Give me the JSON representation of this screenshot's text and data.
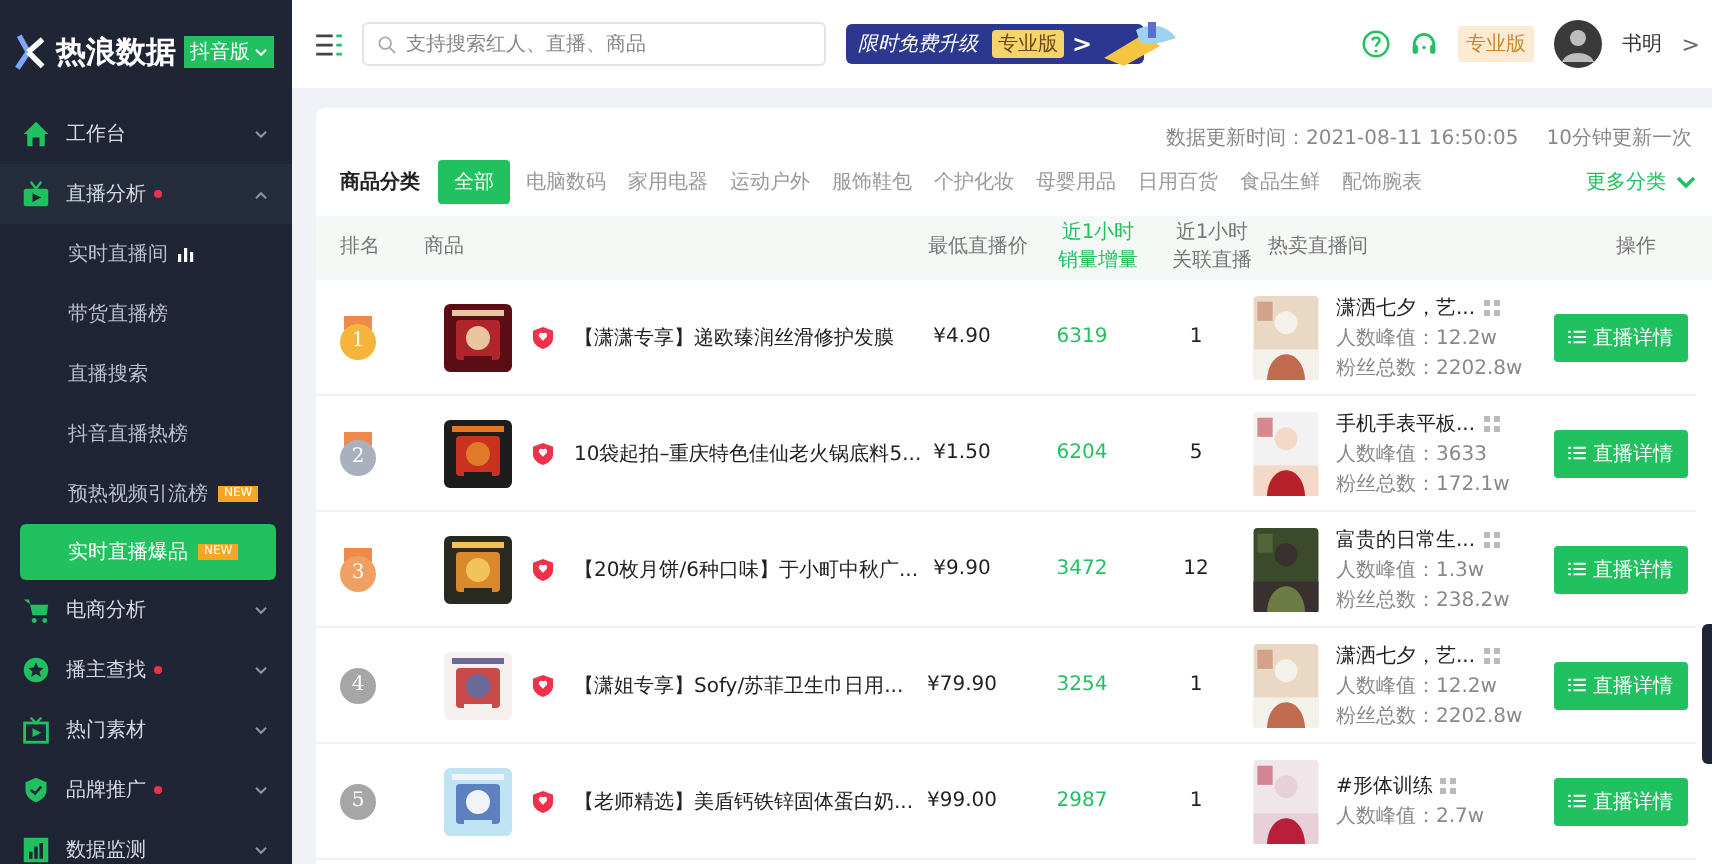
{
  "sidebar": {
    "logo": {
      "title": "热浪数据",
      "edition": "抖音版"
    },
    "items": [
      {
        "label": "工作台",
        "dot": false,
        "expanded": false
      },
      {
        "label": "直播分析",
        "dot": true,
        "expanded": true,
        "children": [
          {
            "label": "实时直播间",
            "selected": false,
            "chart_icon": true
          },
          {
            "label": "带货直播榜",
            "selected": false
          },
          {
            "label": "直播搜索",
            "selected": false
          },
          {
            "label": "抖音直播热榜",
            "selected": false
          },
          {
            "label": "预热视频引流榜",
            "selected": false,
            "badge": "NEW"
          },
          {
            "label": "实时直播爆品",
            "selected": true,
            "badge": "NEW"
          }
        ]
      },
      {
        "label": "电商分析",
        "dot": false,
        "expanded": false
      },
      {
        "label": "播主查找",
        "dot": true,
        "expanded": false
      },
      {
        "label": "热门素材",
        "dot": false,
        "expanded": false
      },
      {
        "label": "品牌推广",
        "dot": true,
        "expanded": false
      },
      {
        "label": "数据监测",
        "dot": false,
        "expanded": false
      }
    ]
  },
  "topbar": {
    "search": {
      "placeholder": "支持搜索红人、直播、商品"
    },
    "promo": {
      "text": "限时免费升级",
      "badge": "专业版",
      "arrow": ">"
    },
    "plan": "专业版",
    "user": "书明",
    "user_arrow": ">"
  },
  "update": {
    "time": "数据更新时间：2021-08-11 16:50:05",
    "interval": "10分钟更新一次"
  },
  "categories": {
    "label": "商品分类",
    "more": "更多分类",
    "tabs": [
      {
        "label": "全部",
        "selected": true
      },
      {
        "label": "电脑数码",
        "selected": false
      },
      {
        "label": "家用电器",
        "selected": false
      },
      {
        "label": "运动户外",
        "selected": false
      },
      {
        "label": "服饰鞋包",
        "selected": false
      },
      {
        "label": "个护化妆",
        "selected": false
      },
      {
        "label": "母婴用品",
        "selected": false
      },
      {
        "label": "日用百货",
        "selected": false
      },
      {
        "label": "食品生鲜",
        "selected": false
      },
      {
        "label": "配饰腕表",
        "selected": false
      }
    ]
  },
  "table": {
    "columns": [
      {
        "lines": [
          "排名"
        ],
        "highlight": false
      },
      {
        "lines": [
          "商品"
        ],
        "highlight": false
      },
      {
        "lines": [
          "最低直播价"
        ],
        "highlight": false
      },
      {
        "lines": [
          "近1小时",
          "销量增量"
        ],
        "highlight": true
      },
      {
        "lines": [
          "近1小时",
          "关联直播"
        ],
        "highlight": false
      },
      {
        "lines": [
          "热卖直播间"
        ],
        "highlight": false
      },
      {
        "lines": [
          "操作"
        ],
        "highlight": false
      }
    ],
    "rows": [
      {
        "rank": "1",
        "kind": "medal",
        "color": "#f5b43c",
        "product": "【潇潇专享】递欧臻润丝滑修护发膜",
        "price": "¥4.90",
        "sales": "6319",
        "related": "1",
        "room": "潇洒七夕，艺...",
        "peak": "人数峰值：12.2w",
        "fans": "粉丝总数：2202.8w",
        "action": "直播详情"
      },
      {
        "rank": "2",
        "kind": "medal",
        "color": "#a9b1bf",
        "product": "10袋起拍–重庆特色佳仙老火锅底料5...",
        "price": "¥1.50",
        "sales": "6204",
        "related": "5",
        "room": "手机手表平板...",
        "peak": "人数峰值：3633",
        "fans": "粉丝总数：172.1w",
        "action": "直播详情"
      },
      {
        "rank": "3",
        "kind": "medal",
        "color": "#f0a062",
        "product": "【20枚月饼/6种口味】于小町中秋广...",
        "price": "¥9.90",
        "sales": "3472",
        "related": "12",
        "room": "富贵的日常生...",
        "peak": "人数峰值：1.3w",
        "fans": "粉丝总数：238.2w",
        "action": "直播详情"
      },
      {
        "rank": "4",
        "kind": "plain",
        "color": "#a6a6a6",
        "product": "【潇姐专享】Sofy/苏菲卫生巾日用...",
        "price": "¥79.90",
        "sales": "3254",
        "related": "1",
        "room": "潇洒七夕，艺...",
        "peak": "人数峰值：12.2w",
        "fans": "粉丝总数：2202.8w",
        "action": "直播详情"
      },
      {
        "rank": "5",
        "kind": "plain",
        "color": "#a6a6a6",
        "product": "【老师精选】美盾钙铁锌固体蛋白奶...",
        "price": "¥99.00",
        "sales": "2987",
        "related": "1",
        "room": "#形体训练",
        "peak": "人数峰值：2.7w",
        "action": "直播详情"
      }
    ]
  }
}
